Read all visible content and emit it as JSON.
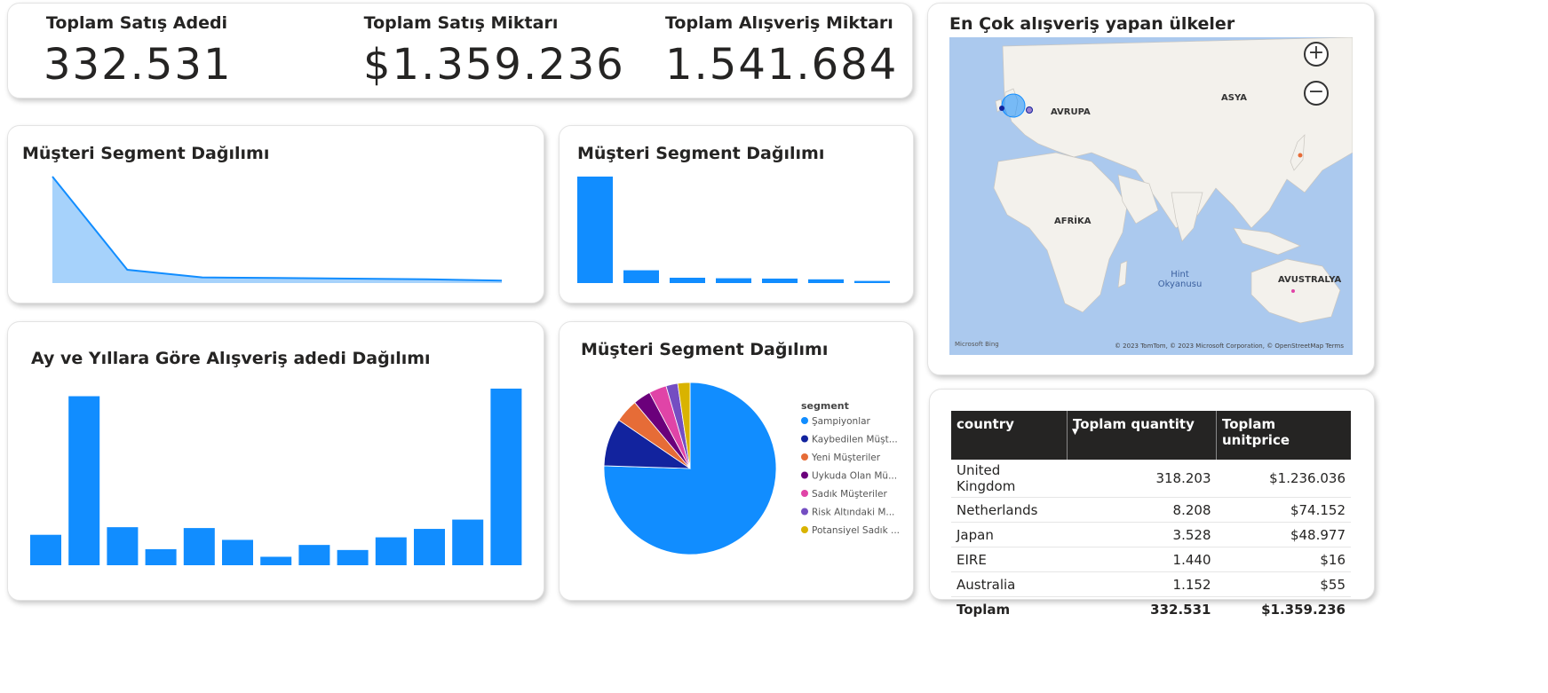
{
  "kpis": [
    {
      "label": "Toplam Satış Adedi",
      "value": "332.531"
    },
    {
      "label": "Toplam Satış Miktarı",
      "value": "$1.359.236"
    },
    {
      "label": "Toplam Alışveriş Miktarı",
      "value": "1.541.684"
    }
  ],
  "colors": {
    "accent": "#118dff",
    "area_fill": "#a6d2fb",
    "table_header": "#252423"
  },
  "segment_area": {
    "title": "Müşteri Segment Dağılımı"
  },
  "segment_bar": {
    "title": "Müşteri Segment Dağılımı"
  },
  "segment_pie": {
    "title": "Müşteri Segment Dağılımı",
    "legend_title": "segment"
  },
  "monthly": {
    "title": "Ay ve Yıllara Göre Alışveriş adedi Dağılımı"
  },
  "map": {
    "title": "En Çok alışveriş yapan ülkeler",
    "labels": {
      "europe": "AVRUPA",
      "asia": "ASYA",
      "africa": "AFRİKA",
      "ocean": "Hint Okyanusu",
      "australia": "AVUSTRALYA"
    },
    "attribution": "© 2023 TomTom, © 2023 Microsoft Corporation, © OpenStreetMap  Terms",
    "brand": "Microsoft Bing",
    "zoom_in": "+",
    "zoom_out": "−"
  },
  "table": {
    "headers": [
      "country",
      "Toplam quantity",
      "Toplam unitprice"
    ],
    "rows": [
      [
        "United Kingdom",
        "318.203",
        "$1.236.036"
      ],
      [
        "Netherlands",
        "8.208",
        "$74.152"
      ],
      [
        "Japan",
        "3.528",
        "$48.977"
      ],
      [
        "EIRE",
        "1.440",
        "$16"
      ],
      [
        "Australia",
        "1.152",
        "$55"
      ]
    ],
    "total": [
      "Toplam",
      "332.531",
      "$1.359.236"
    ]
  },
  "chart_data": [
    {
      "type": "area",
      "title": "Müşteri Segment Dağılımı",
      "x": [
        1,
        2,
        3,
        4,
        5,
        6,
        7
      ],
      "values": [
        100,
        12.5,
        5.3,
        4.8,
        4.2,
        3.5,
        2.3
      ],
      "ylim": [
        0,
        100
      ]
    },
    {
      "type": "bar",
      "title": "Müşteri Segment Dağılımı",
      "values": [
        100,
        12,
        5,
        4.5,
        4.2,
        3.5,
        2
      ],
      "ylim": [
        0,
        100
      ]
    },
    {
      "type": "bar",
      "title": "Ay ve Yıllara Göre Alışveriş adedi Dağılımı",
      "values": [
        18,
        100,
        22.5,
        9.5,
        22,
        15,
        5,
        12,
        9,
        16.5,
        21.5,
        27,
        104.5
      ],
      "ylim": [
        0,
        105
      ]
    },
    {
      "type": "pie",
      "title": "Müşteri Segment Dağılımı",
      "legend_title": "segment",
      "legend_position": "right",
      "slices": [
        {
          "label": "Şampiyonlar",
          "value": 75.5,
          "color": "#118dff"
        },
        {
          "label": "Kaybedilen Müşt...",
          "value": 9.0,
          "color": "#12239e"
        },
        {
          "label": "Yeni Müşteriler",
          "value": 4.4,
          "color": "#e66c37"
        },
        {
          "label": "Uykuda Olan Mü...",
          "value": 3.3,
          "color": "#6b007b"
        },
        {
          "label": "Sadık Müşteriler",
          "value": 3.3,
          "color": "#e044a7"
        },
        {
          "label": "Risk Altındaki M...",
          "value": 2.2,
          "color": "#744ec2"
        },
        {
          "label": "Potansiyel Sadık ...",
          "value": 2.3,
          "color": "#d9b300"
        }
      ]
    }
  ]
}
